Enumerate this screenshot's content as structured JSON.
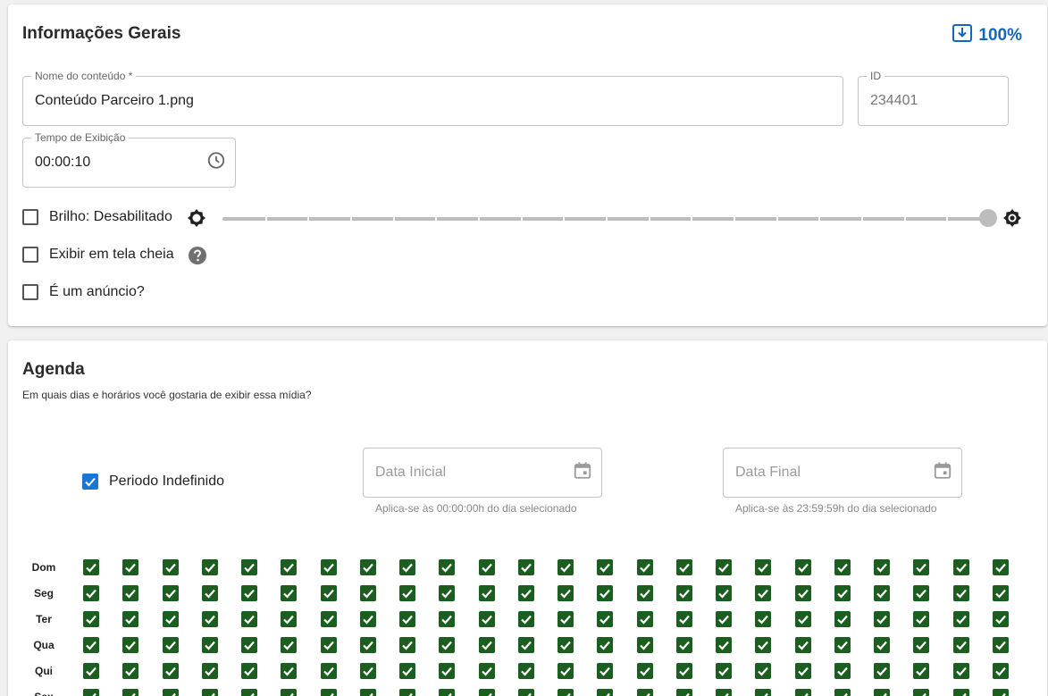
{
  "general": {
    "title": "Informações Gerais",
    "progress": "100%",
    "content_name_label": "Nome do conteúdo *",
    "content_name_value": "Conteúdo Parceiro 1.png",
    "id_label": "ID",
    "id_value": "234401",
    "time_label": "Tempo de Exibição",
    "time_value": "00:00:10",
    "brightness_label": "Brilho: Desabilitado",
    "brightness_level": 1.0,
    "fullscreen_label": "Exibir em tela cheia",
    "ad_label": "É um anúncio?"
  },
  "agenda": {
    "title": "Agenda",
    "subtitle": "Em quais dias e horários você gostaria de exibir essa mídia?",
    "undefined_period_label": "Periodo Indefinido",
    "undefined_period_checked": true,
    "start_placeholder": "Data Inicial",
    "start_helper": "Aplica-se às 00:00:00h do dia selecionado",
    "end_placeholder": "Data Final",
    "end_helper": "Aplica-se às 23:59:59h do dia selecionado",
    "days": [
      "Dom",
      "Seg",
      "Ter",
      "Qua",
      "Qui",
      "Sex"
    ],
    "hours_count": 24,
    "all_checked": true
  },
  "colors": {
    "accent": "#1565c0",
    "checked_green": "#1b5e20",
    "checkbox_blue": "#1976d2"
  }
}
